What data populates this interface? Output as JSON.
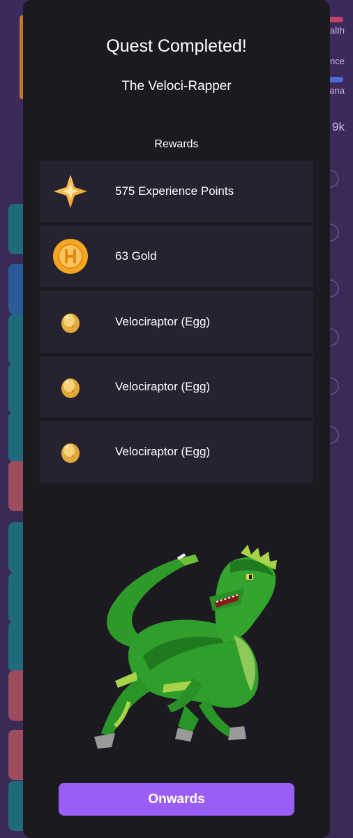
{
  "background": {
    "stats": [
      "alth",
      "nce",
      "ana",
      "9k"
    ]
  },
  "modal": {
    "title": "Quest Completed!",
    "quest_name": "The Veloci-Rapper",
    "rewards_label": "Rewards",
    "rewards": [
      {
        "label": "575 Experience Points",
        "icon": "star-icon"
      },
      {
        "label": "63 Gold",
        "icon": "gold-coin-icon"
      },
      {
        "label": "Velociraptor (Egg)",
        "icon": "egg-icon"
      },
      {
        "label": "Velociraptor (Egg)",
        "icon": "egg-icon"
      },
      {
        "label": "Velociraptor (Egg)",
        "icon": "egg-icon"
      }
    ],
    "pet_image": "velociraptor-pet-image",
    "button_label": "Onwards"
  },
  "colors": {
    "modal_bg": "#1c1a20",
    "row_bg": "#252330",
    "button": "#9a5ef5",
    "app_bg": "#3b2a5a"
  }
}
